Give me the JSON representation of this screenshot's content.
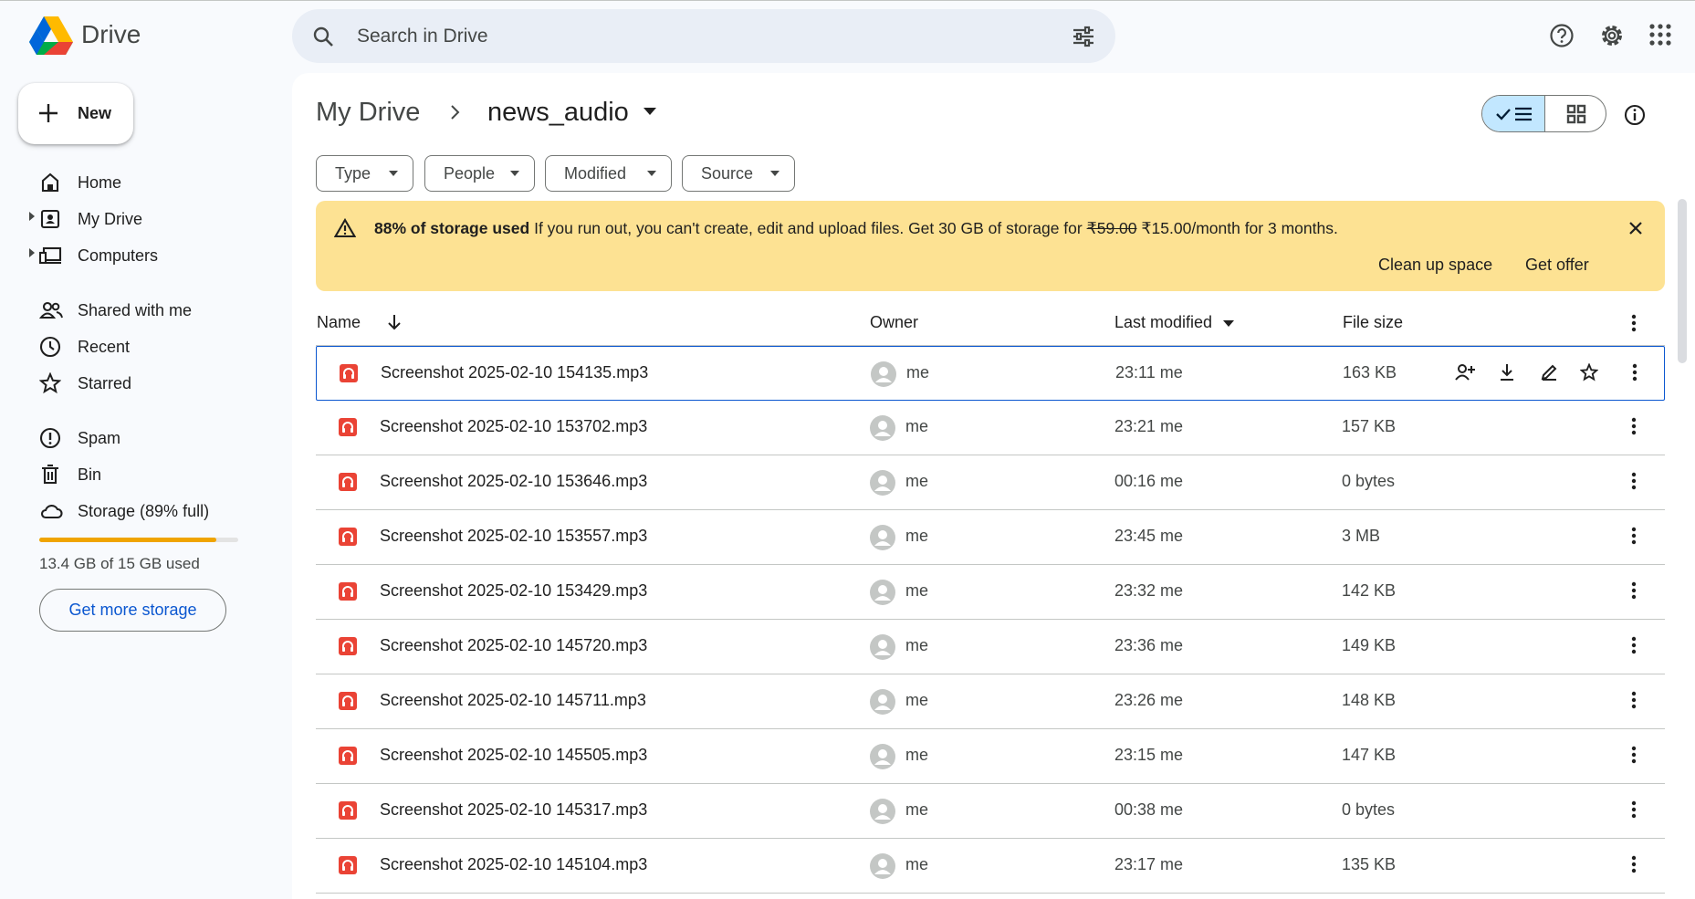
{
  "app": {
    "brand": "Drive"
  },
  "search": {
    "placeholder": "Search in Drive"
  },
  "new_button": {
    "label": "New"
  },
  "sidebar": {
    "items": [
      {
        "label": "Home",
        "icon": "home-icon"
      },
      {
        "label": "My Drive",
        "icon": "my-drive-icon"
      },
      {
        "label": "Computers",
        "icon": "computers-icon"
      },
      {
        "label": "Shared with me",
        "icon": "shared-icon"
      },
      {
        "label": "Recent",
        "icon": "clock-icon"
      },
      {
        "label": "Starred",
        "icon": "star-icon"
      },
      {
        "label": "Spam",
        "icon": "spam-icon"
      },
      {
        "label": "Bin",
        "icon": "bin-icon"
      },
      {
        "label": "Storage (89% full)",
        "icon": "cloud-icon"
      }
    ],
    "storage": {
      "used_fraction": 0.89,
      "text": "13.4 GB of 15 GB used",
      "button": "Get more storage"
    }
  },
  "breadcrumb": {
    "root": "My Drive",
    "current": "news_audio"
  },
  "filters": [
    "Type",
    "People",
    "Modified",
    "Source"
  ],
  "banner": {
    "title": "88% of storage used",
    "message": "If you run out, you can't create, edit and upload files. Get 30 GB of storage for",
    "old_price": "₹59.00",
    "new_price": "₹15.00/month for 3 months.",
    "action_cleanup": "Clean up space",
    "action_offer": "Get offer"
  },
  "table": {
    "headers": {
      "name": "Name",
      "owner": "Owner",
      "modified": "Last modified",
      "size": "File size"
    },
    "rows": [
      {
        "name": "Screenshot 2025-02-10 154135.mp3",
        "owner": "me",
        "modified": "23:11 me",
        "size": "163 KB"
      },
      {
        "name": "Screenshot 2025-02-10 153702.mp3",
        "owner": "me",
        "modified": "23:21 me",
        "size": "157 KB"
      },
      {
        "name": "Screenshot 2025-02-10 153646.mp3",
        "owner": "me",
        "modified": "00:16 me",
        "size": "0 bytes"
      },
      {
        "name": "Screenshot 2025-02-10 153557.mp3",
        "owner": "me",
        "modified": "23:45 me",
        "size": "3 MB"
      },
      {
        "name": "Screenshot 2025-02-10 153429.mp3",
        "owner": "me",
        "modified": "23:32 me",
        "size": "142 KB"
      },
      {
        "name": "Screenshot 2025-02-10 145720.mp3",
        "owner": "me",
        "modified": "23:36 me",
        "size": "149 KB"
      },
      {
        "name": "Screenshot 2025-02-10 145711.mp3",
        "owner": "me",
        "modified": "23:26 me",
        "size": "148 KB"
      },
      {
        "name": "Screenshot 2025-02-10 145505.mp3",
        "owner": "me",
        "modified": "23:15 me",
        "size": "147 KB"
      },
      {
        "name": "Screenshot 2025-02-10 145317.mp3",
        "owner": "me",
        "modified": "00:38 me",
        "size": "0 bytes"
      },
      {
        "name": "Screenshot 2025-02-10 145104.mp3",
        "owner": "me",
        "modified": "23:17 me",
        "size": "135 KB"
      }
    ]
  },
  "colors": {
    "accent": "#0b57d0",
    "banner": "#fde293",
    "file_icon": "#ea4335",
    "storage_bar": "#f0a400"
  }
}
